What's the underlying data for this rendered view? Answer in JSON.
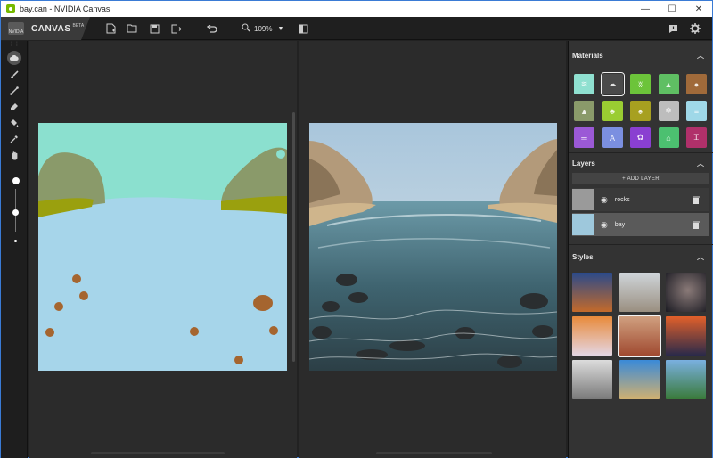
{
  "window": {
    "title": "bay.can - NVIDIA Canvas",
    "controls": {
      "minimize": "—",
      "maximize": "☐",
      "close": "✕"
    }
  },
  "toolbar": {
    "brand": "CANVAS",
    "beta": "BETA",
    "logo_text": "NVIDIA",
    "zoom": "109%",
    "icons": [
      "new-file-icon",
      "open-folder-icon",
      "save-icon",
      "export-icon",
      "undo-icon",
      "zoom-icon",
      "panel-toggle-icon",
      "feedback-icon",
      "settings-icon"
    ]
  },
  "tools": [
    "cloud-brush-icon",
    "brush-icon",
    "line-icon",
    "eraser-icon",
    "fill-bucket-icon",
    "eyedropper-icon",
    "pan-hand-icon"
  ],
  "brush": {
    "size_level": 0.55
  },
  "materials": {
    "title": "Materials",
    "items": [
      {
        "name": "water",
        "color": "#8fe0d0",
        "glyph": "≋"
      },
      {
        "name": "cloud",
        "color": "#4a4a4a",
        "glyph": "☁",
        "selected": true
      },
      {
        "name": "grass",
        "color": "#6cc43a",
        "glyph": "ʬ"
      },
      {
        "name": "hill",
        "color": "#5fbf63",
        "glyph": "▲"
      },
      {
        "name": "rock",
        "color": "#a06a3a",
        "glyph": "●"
      },
      {
        "name": "mountain",
        "color": "#8a9a6a",
        "glyph": "▲"
      },
      {
        "name": "tree",
        "color": "#9acd32",
        "glyph": "♣"
      },
      {
        "name": "palm",
        "color": "#a7a020",
        "glyph": "♠"
      },
      {
        "name": "snow",
        "color": "#bdbdbd",
        "glyph": "❄"
      },
      {
        "name": "sky",
        "color": "#9fd8e8",
        "glyph": "≡"
      },
      {
        "name": "road",
        "color": "#9b59d6",
        "glyph": "═"
      },
      {
        "name": "bridge",
        "color": "#7b8fe0",
        "glyph": "A"
      },
      {
        "name": "flower",
        "color": "#8a3fd1",
        "glyph": "✿"
      },
      {
        "name": "house",
        "color": "#4cc070",
        "glyph": "⌂"
      },
      {
        "name": "pier",
        "color": "#b0306a",
        "glyph": "Ꮖ"
      }
    ]
  },
  "layers": {
    "title": "Layers",
    "add_label": "+ ADD LAYER",
    "items": [
      {
        "name": "rocks",
        "thumb": "#9a9a9a"
      },
      {
        "name": "bay",
        "thumb": "#9ec8dc",
        "selected": true
      }
    ]
  },
  "styles": {
    "title": "Styles",
    "items": [
      {
        "name": "desert-dusk",
        "gradient": "linear-gradient(#2b4a8a, #c46a2a)"
      },
      {
        "name": "cloudy-peak",
        "gradient": "linear-gradient(#cfd5da, #9a8f80)"
      },
      {
        "name": "night-arch",
        "gradient": "radial-gradient(circle at 55% 45%, #8a7a78, #1a1a22)"
      },
      {
        "name": "sunset-fog",
        "gradient": "linear-gradient(#e88a3a, #e4d6e4)"
      },
      {
        "name": "red-rocks",
        "gradient": "linear-gradient(#d0a080, #a04a30)",
        "selected": true
      },
      {
        "name": "ocean-sunset",
        "gradient": "linear-gradient(#e2602a, #2a2a4a)"
      },
      {
        "name": "misty-trees",
        "gradient": "linear-gradient(#dcdcdc, #7a7a7a)"
      },
      {
        "name": "tropical-bay",
        "gradient": "linear-gradient(#3a8ad8, #d0b070)"
      },
      {
        "name": "alpine-lake",
        "gradient": "linear-gradient(#7ab0e0, #3a7a3a)"
      }
    ]
  }
}
